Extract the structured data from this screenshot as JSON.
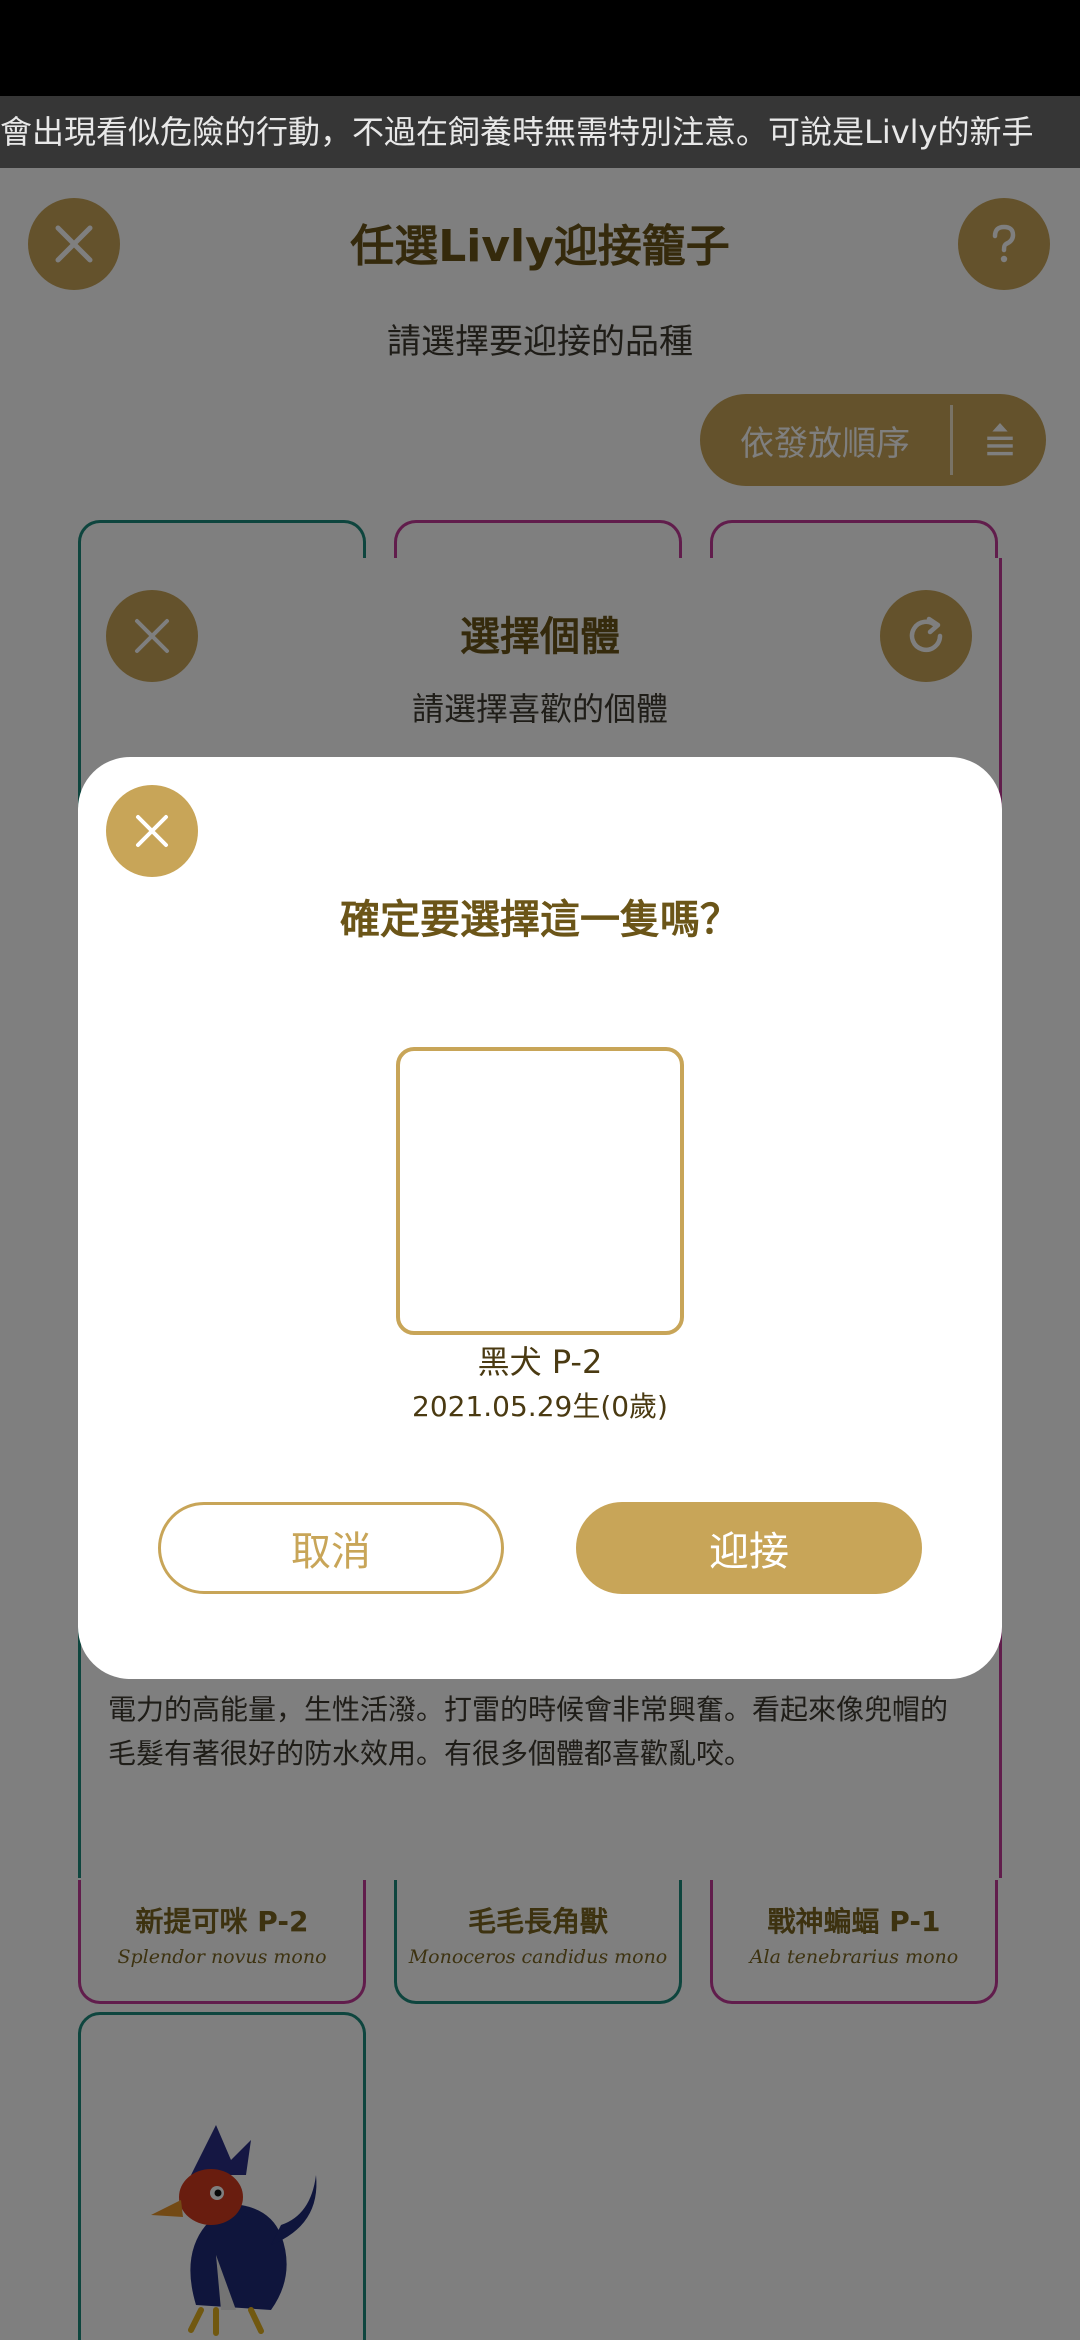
{
  "ticker": {
    "text": "會出現看似危險的行動，不過在飼養時無需特別注意。可說是Livly的新手"
  },
  "header": {
    "title": "任選Livly迎接籠子",
    "subtitle": "請選擇要迎接的品種",
    "close_icon": "close-icon",
    "help_icon": "question-icon"
  },
  "sort": {
    "label": "依發放順序",
    "icon": "sort-order-icon"
  },
  "panel": {
    "title": "選擇個體",
    "subtitle": "請選擇喜歡的個體",
    "close_icon": "close-icon",
    "refresh_icon": "refresh-icon",
    "description_line1": "電力的高能量，生性活潑。打雷的時候會非常興奮。看起來像兜帽的",
    "description_line2": "毛髮有著很好的防水效用。有很多個體都喜歡亂咬。"
  },
  "cards": [
    {
      "name": "新提可咪 P-2",
      "latin": "Splendor novus mono",
      "border": "#c23b98"
    },
    {
      "name": "毛毛長角獸",
      "latin": "Monoceros candidus mono",
      "border": "#1d8a7c"
    },
    {
      "name": "戰神蝙蝠 P-1",
      "latin": "Ala tenebrarius mono",
      "border": "#c23b98"
    }
  ],
  "modal": {
    "title": "確定要選擇這一隻嗎？",
    "pet_name": "黑犬 P-2",
    "pet_birth": "2021.05.29生(0歲)",
    "cancel_label": "取消",
    "confirm_label": "迎接",
    "close_icon": "close-icon"
  },
  "colors": {
    "accent": "#c8a558",
    "title": "#6b5518",
    "teal": "#1d8a7c",
    "pink": "#c23b98",
    "overlay": "rgba(0,0,0,0.5)"
  }
}
